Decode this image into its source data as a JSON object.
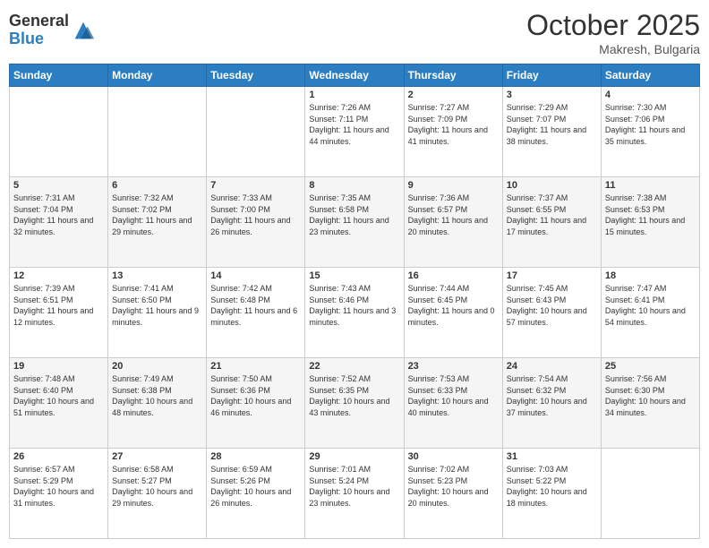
{
  "header": {
    "logo_general": "General",
    "logo_blue": "Blue",
    "month": "October 2025",
    "location": "Makresh, Bulgaria"
  },
  "weekdays": [
    "Sunday",
    "Monday",
    "Tuesday",
    "Wednesday",
    "Thursday",
    "Friday",
    "Saturday"
  ],
  "weeks": [
    [
      {
        "day": "",
        "info": ""
      },
      {
        "day": "",
        "info": ""
      },
      {
        "day": "",
        "info": ""
      },
      {
        "day": "1",
        "info": "Sunrise: 7:26 AM\nSunset: 7:11 PM\nDaylight: 11 hours and 44 minutes."
      },
      {
        "day": "2",
        "info": "Sunrise: 7:27 AM\nSunset: 7:09 PM\nDaylight: 11 hours and 41 minutes."
      },
      {
        "day": "3",
        "info": "Sunrise: 7:29 AM\nSunset: 7:07 PM\nDaylight: 11 hours and 38 minutes."
      },
      {
        "day": "4",
        "info": "Sunrise: 7:30 AM\nSunset: 7:06 PM\nDaylight: 11 hours and 35 minutes."
      }
    ],
    [
      {
        "day": "5",
        "info": "Sunrise: 7:31 AM\nSunset: 7:04 PM\nDaylight: 11 hours and 32 minutes."
      },
      {
        "day": "6",
        "info": "Sunrise: 7:32 AM\nSunset: 7:02 PM\nDaylight: 11 hours and 29 minutes."
      },
      {
        "day": "7",
        "info": "Sunrise: 7:33 AM\nSunset: 7:00 PM\nDaylight: 11 hours and 26 minutes."
      },
      {
        "day": "8",
        "info": "Sunrise: 7:35 AM\nSunset: 6:58 PM\nDaylight: 11 hours and 23 minutes."
      },
      {
        "day": "9",
        "info": "Sunrise: 7:36 AM\nSunset: 6:57 PM\nDaylight: 11 hours and 20 minutes."
      },
      {
        "day": "10",
        "info": "Sunrise: 7:37 AM\nSunset: 6:55 PM\nDaylight: 11 hours and 17 minutes."
      },
      {
        "day": "11",
        "info": "Sunrise: 7:38 AM\nSunset: 6:53 PM\nDaylight: 11 hours and 15 minutes."
      }
    ],
    [
      {
        "day": "12",
        "info": "Sunrise: 7:39 AM\nSunset: 6:51 PM\nDaylight: 11 hours and 12 minutes."
      },
      {
        "day": "13",
        "info": "Sunrise: 7:41 AM\nSunset: 6:50 PM\nDaylight: 11 hours and 9 minutes."
      },
      {
        "day": "14",
        "info": "Sunrise: 7:42 AM\nSunset: 6:48 PM\nDaylight: 11 hours and 6 minutes."
      },
      {
        "day": "15",
        "info": "Sunrise: 7:43 AM\nSunset: 6:46 PM\nDaylight: 11 hours and 3 minutes."
      },
      {
        "day": "16",
        "info": "Sunrise: 7:44 AM\nSunset: 6:45 PM\nDaylight: 11 hours and 0 minutes."
      },
      {
        "day": "17",
        "info": "Sunrise: 7:45 AM\nSunset: 6:43 PM\nDaylight: 10 hours and 57 minutes."
      },
      {
        "day": "18",
        "info": "Sunrise: 7:47 AM\nSunset: 6:41 PM\nDaylight: 10 hours and 54 minutes."
      }
    ],
    [
      {
        "day": "19",
        "info": "Sunrise: 7:48 AM\nSunset: 6:40 PM\nDaylight: 10 hours and 51 minutes."
      },
      {
        "day": "20",
        "info": "Sunrise: 7:49 AM\nSunset: 6:38 PM\nDaylight: 10 hours and 48 minutes."
      },
      {
        "day": "21",
        "info": "Sunrise: 7:50 AM\nSunset: 6:36 PM\nDaylight: 10 hours and 46 minutes."
      },
      {
        "day": "22",
        "info": "Sunrise: 7:52 AM\nSunset: 6:35 PM\nDaylight: 10 hours and 43 minutes."
      },
      {
        "day": "23",
        "info": "Sunrise: 7:53 AM\nSunset: 6:33 PM\nDaylight: 10 hours and 40 minutes."
      },
      {
        "day": "24",
        "info": "Sunrise: 7:54 AM\nSunset: 6:32 PM\nDaylight: 10 hours and 37 minutes."
      },
      {
        "day": "25",
        "info": "Sunrise: 7:56 AM\nSunset: 6:30 PM\nDaylight: 10 hours and 34 minutes."
      }
    ],
    [
      {
        "day": "26",
        "info": "Sunrise: 6:57 AM\nSunset: 5:29 PM\nDaylight: 10 hours and 31 minutes."
      },
      {
        "day": "27",
        "info": "Sunrise: 6:58 AM\nSunset: 5:27 PM\nDaylight: 10 hours and 29 minutes."
      },
      {
        "day": "28",
        "info": "Sunrise: 6:59 AM\nSunset: 5:26 PM\nDaylight: 10 hours and 26 minutes."
      },
      {
        "day": "29",
        "info": "Sunrise: 7:01 AM\nSunset: 5:24 PM\nDaylight: 10 hours and 23 minutes."
      },
      {
        "day": "30",
        "info": "Sunrise: 7:02 AM\nSunset: 5:23 PM\nDaylight: 10 hours and 20 minutes."
      },
      {
        "day": "31",
        "info": "Sunrise: 7:03 AM\nSunset: 5:22 PM\nDaylight: 10 hours and 18 minutes."
      },
      {
        "day": "",
        "info": ""
      }
    ]
  ]
}
